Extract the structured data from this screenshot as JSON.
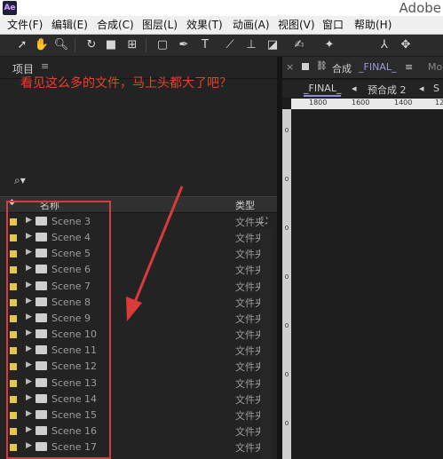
{
  "window": {
    "brand": "Adobe",
    "app_icon": "Ae"
  },
  "menu": [
    "文件(F)",
    "编辑(E)",
    "合成(C)",
    "图层(L)",
    "效果(T)",
    "动画(A)",
    "视图(V)",
    "窗口",
    "帮助(H)"
  ],
  "toolbar": {
    "tools": [
      "selection-tool-icon",
      "hand-tool-icon",
      "zoom-tool-icon",
      "rotate-tool-icon",
      "camera-tool-icon",
      "pan-behind-tool-icon",
      "rectangle-tool-icon",
      "pen-tool-icon",
      "type-tool-icon",
      "brush-tool-icon",
      "clone-stamp-tool-icon",
      "eraser-tool-icon",
      "roto-brush-tool-icon",
      "puppet-pin-tool-icon",
      "axis-local-icon",
      "axis-world-icon"
    ],
    "type_tool_label": "T"
  },
  "project_panel": {
    "title": "项目",
    "menu_glyph": "≡",
    "annotation": "看见这么多的文件，马上头都大了吧？",
    "search_glyph": "⌕▾",
    "headers": {
      "name": "名称",
      "type": "类型"
    },
    "rows": [
      {
        "name": "Scene 3",
        "type": "文件夹"
      },
      {
        "name": "Scene 4",
        "type": "文件夹"
      },
      {
        "name": "Scene 5",
        "type": "文件夹"
      },
      {
        "name": "Scene 6",
        "type": "文件夹"
      },
      {
        "name": "Scene 7",
        "type": "文件夹"
      },
      {
        "name": "Scene 8",
        "type": "文件夹"
      },
      {
        "name": "Scene 9",
        "type": "文件夹"
      },
      {
        "name": "Scene 10",
        "type": "文件夹"
      },
      {
        "name": "Scene 11",
        "type": "文件夹"
      },
      {
        "name": "Scene 12",
        "type": "文件夹"
      },
      {
        "name": "Scene 13",
        "type": "文件夹"
      },
      {
        "name": "Scene 14",
        "type": "文件夹"
      },
      {
        "name": "Scene 15",
        "type": "文件夹"
      },
      {
        "name": "Scene 16",
        "type": "文件夹"
      },
      {
        "name": "Scene 17",
        "type": "文件夹"
      }
    ],
    "label_color": "#e3c64a",
    "highlight_color": "#d93a3a"
  },
  "comp_panel": {
    "tab_prefix": "合成",
    "tab_name": "_FINAL_",
    "tab_menu": "≡",
    "next_tab": "Mo",
    "breadcrumb_active": "_FINAL_",
    "breadcrumb_sub": "预合成 2",
    "breadcrumb_more": "S",
    "ruler_numbers": [
      "1800",
      "1600",
      "1400",
      "12"
    ],
    "vertical_ticks": [
      "0",
      "0",
      "0",
      "0",
      "0",
      "0",
      "0"
    ]
  }
}
